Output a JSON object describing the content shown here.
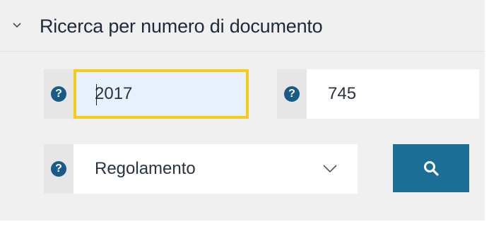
{
  "section": {
    "title": "Ricerca per numero di documento"
  },
  "fields": {
    "year": {
      "value": "2017",
      "help": "?"
    },
    "number": {
      "value": "745",
      "help": "?"
    },
    "type": {
      "selected": "Regolamento",
      "help": "?"
    }
  },
  "icons": {
    "collapse": "chevron-down-icon",
    "select": "chevron-down-icon",
    "search": "search-icon",
    "help": "question-icon"
  },
  "colors": {
    "panel_bg": "#f0f0f0",
    "help_icon": "#1a5a86",
    "focus_border": "#f4cd1a",
    "focus_bg": "#e6f1fb",
    "search_button": "#1b6e96"
  }
}
